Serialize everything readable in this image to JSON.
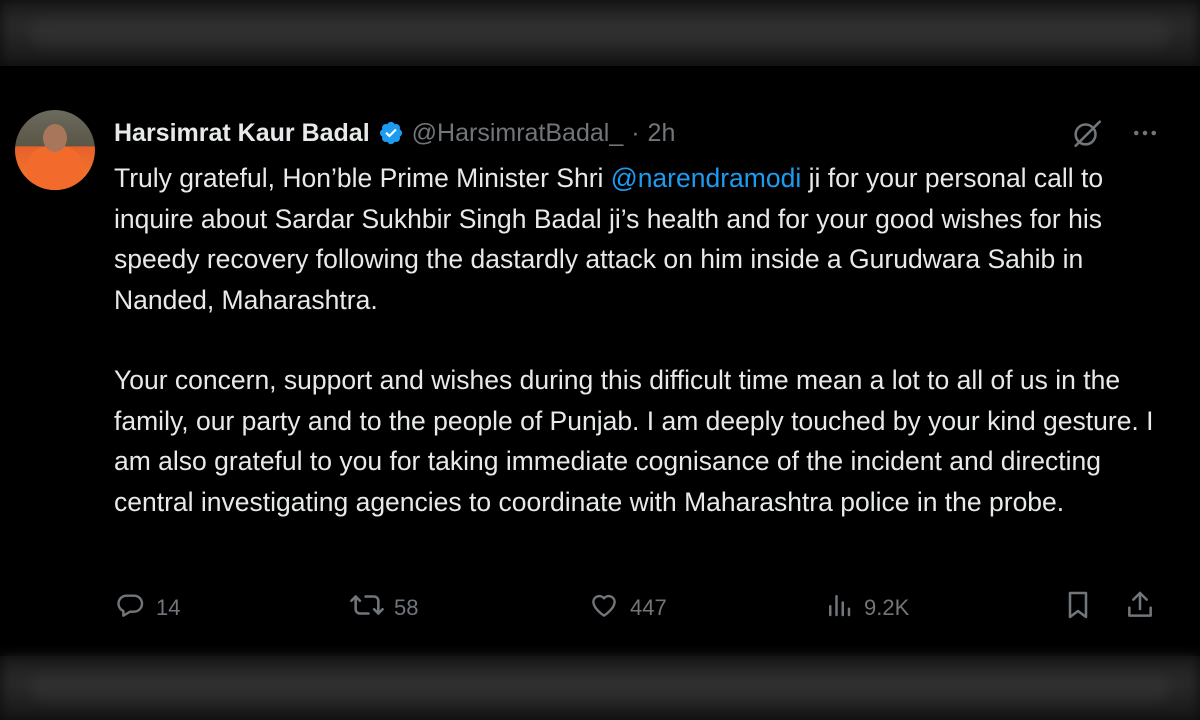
{
  "tweet": {
    "author_name": "Harsimrat Kaur Badal",
    "handle": "@HarsimratBadal_",
    "separator": "·",
    "time": "2h",
    "text_before_mention": "Truly grateful, Hon’ble Prime Minister Shri ",
    "mention": "@narendramodi",
    "text_after_mention": " ji for your personal call to inquire about Sardar Sukhbir Singh Badal ji’s health and for your good wishes for his speedy recovery following the dastardly attack on him inside a Gurudwara Sahib in Nanded, Maharashtra.",
    "paragraph2": "Your concern, support and wishes during this difficult time mean a lot to all of us in the family, our party and to the people of Punjab. I am deeply touched by your kind gesture. I am also grateful to you for taking immediate cognisance of the incident and directing central investigating agencies to coordinate with Maharashtra police in the probe.",
    "replies": "14",
    "reposts": "58",
    "likes": "447",
    "views": "9.2K"
  },
  "icons": {
    "verified": "verified-badge-icon",
    "grok": "grok-icon",
    "more": "more-icon",
    "reply": "reply-icon",
    "repost": "repost-icon",
    "like": "heart-icon",
    "views": "views-icon",
    "bookmark": "bookmark-icon",
    "share": "share-icon"
  },
  "colors": {
    "background": "#000000",
    "text": "#e7e9ea",
    "secondary": "#71767b",
    "accent": "#1d9bf0"
  }
}
